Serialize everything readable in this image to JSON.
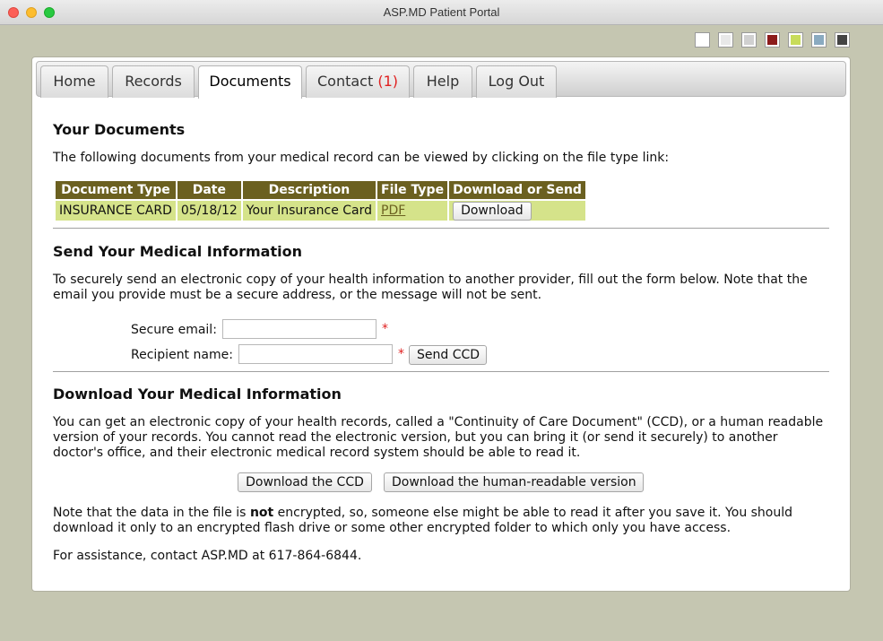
{
  "window": {
    "title": "ASP.MD Patient Portal"
  },
  "theme_swatches": [
    "#ffffff",
    "#e8e8e8",
    "#d0d0d0",
    "#8c1b1b",
    "#c8dc5a",
    "#8aaac0",
    "#444444"
  ],
  "tabs": [
    {
      "label": "Home"
    },
    {
      "label": "Records"
    },
    {
      "label": "Documents",
      "active": true
    },
    {
      "label": "Contact",
      "badge": "(1)"
    },
    {
      "label": "Help"
    },
    {
      "label": "Log Out"
    }
  ],
  "documents": {
    "heading": "Your Documents",
    "intro": "The following documents from your medical record can be viewed by clicking on the file type link:",
    "columns": [
      "Document Type",
      "Date",
      "Description",
      "File Type",
      "Download or Send"
    ],
    "rows": [
      {
        "type": "INSURANCE CARD",
        "date": "05/18/12",
        "description": "Your Insurance Card",
        "file_type": "PDF",
        "action": "Download"
      }
    ]
  },
  "send": {
    "heading": "Send Your Medical Information",
    "intro": "To securely send an electronic copy of your health information to another provider, fill out the form below. Note that the email you provide must be a secure address, or the message will not be sent.",
    "email_label": "Secure email:",
    "email_value": "",
    "recipient_label": "Recipient name:",
    "recipient_value": "",
    "required_mark": "*",
    "button": "Send CCD"
  },
  "download": {
    "heading": "Download Your Medical Information",
    "intro": "You can get an electronic copy of your health records, called a \"Continuity of Care Document\" (CCD), or a human readable version of your records. You cannot read the electronic version, but you can bring it (or send it securely) to another doctor's office, and their electronic medical record system should be able to read it.",
    "button_ccd": "Download the CCD",
    "button_human": "Download the human-readable version",
    "note_before": "Note that the data in the file is ",
    "note_bold": "not",
    "note_after": " encrypted, so, someone else might be able to read it after you save it. You should download it only to an encrypted flash drive or some other encrypted folder to which only you have access.",
    "assistance": "For assistance, contact ASP.MD at 617-864-6844."
  }
}
